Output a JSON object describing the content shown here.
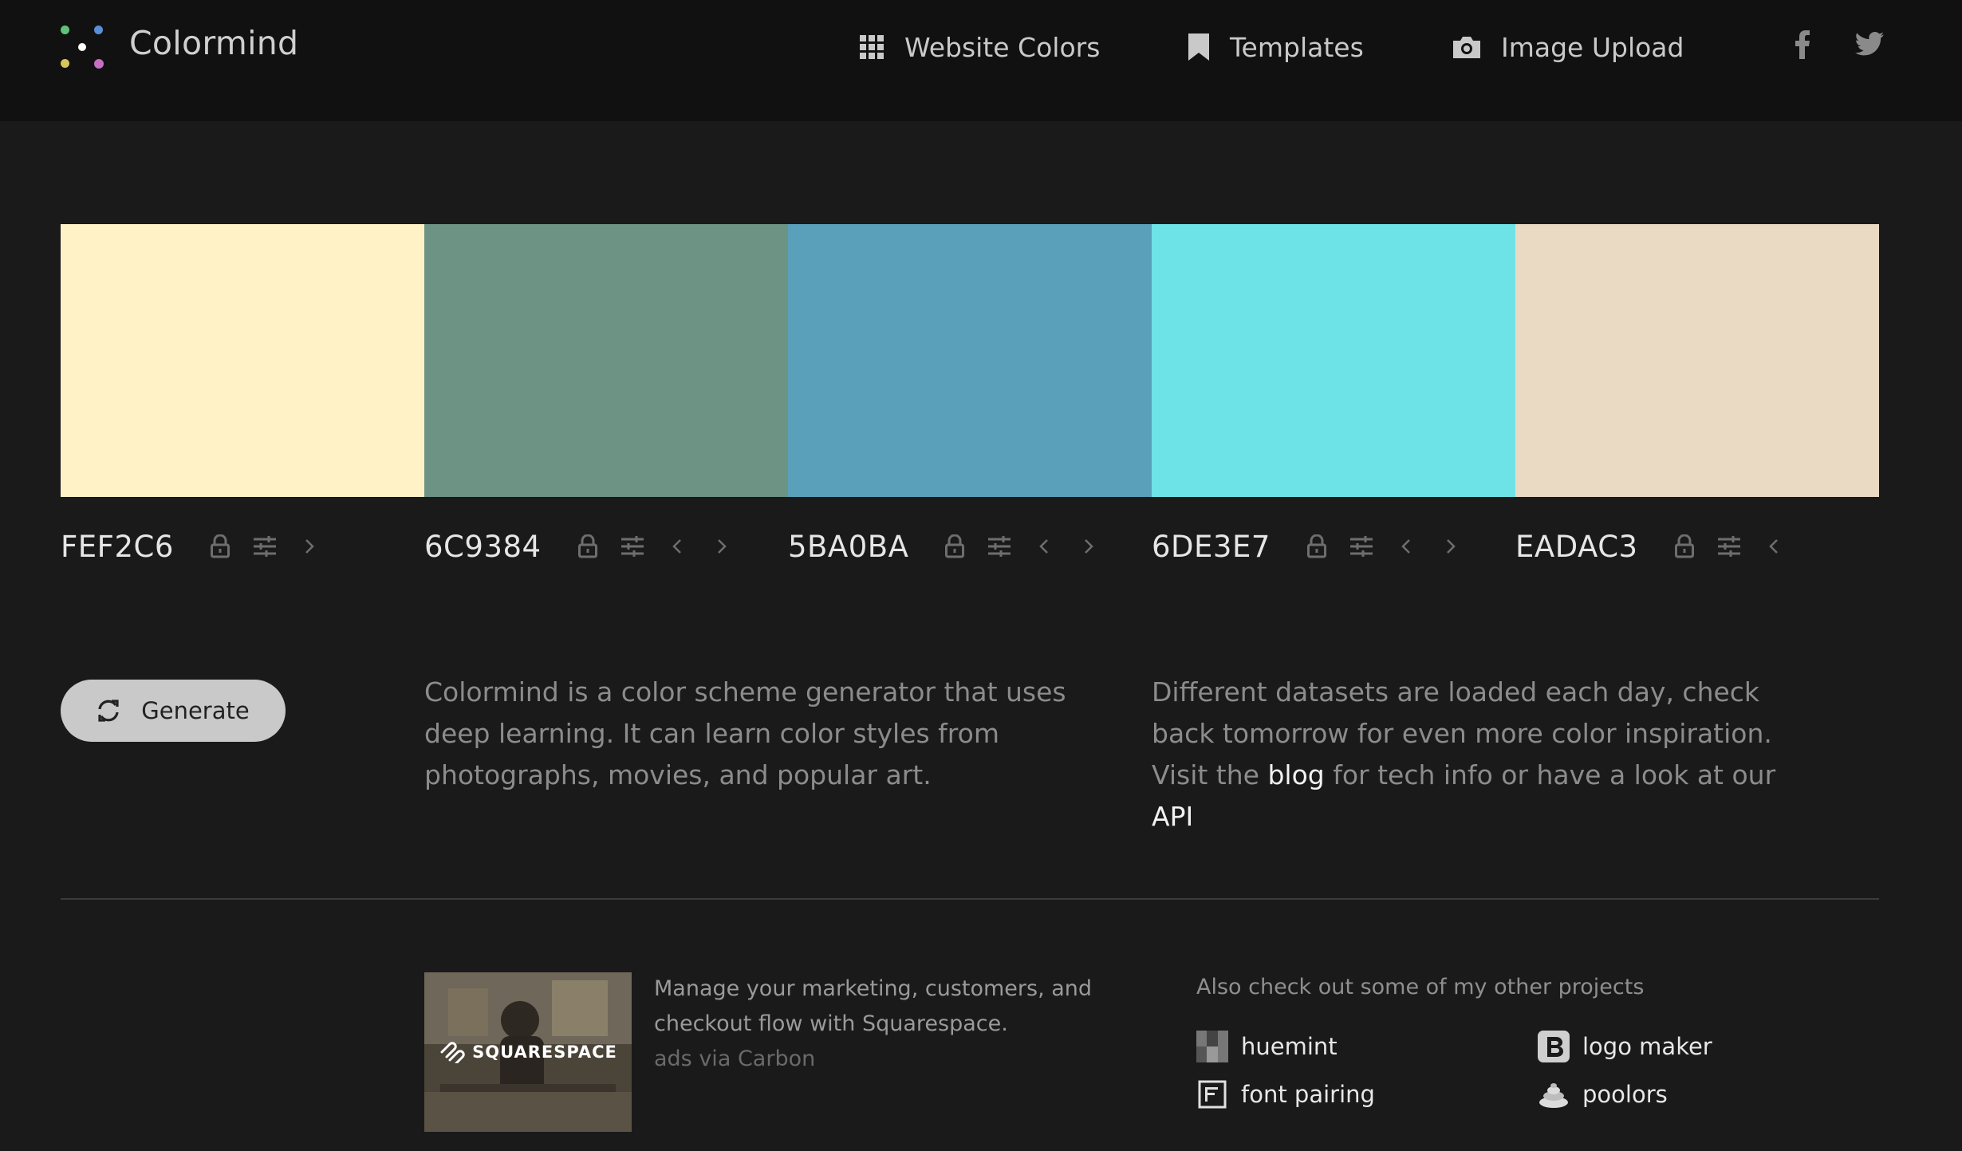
{
  "header": {
    "brand": "Colormind",
    "nav": [
      {
        "label": "Website Colors",
        "icon": "grid-icon"
      },
      {
        "label": "Templates",
        "icon": "bookmark-icon"
      },
      {
        "label": "Image Upload",
        "icon": "camera-icon"
      }
    ],
    "social": [
      "facebook-icon",
      "twitter-icon"
    ]
  },
  "palette": [
    {
      "hex": "FEF2C6",
      "color": "#FEF2C6",
      "controls": [
        "lock-icon",
        "adjust-icon",
        "chevron-right-icon"
      ]
    },
    {
      "hex": "6C9384",
      "color": "#6C9384",
      "controls": [
        "lock-icon",
        "adjust-icon",
        "chevron-left-icon",
        "chevron-right-icon"
      ]
    },
    {
      "hex": "5BA0BA",
      "color": "#5BA0BA",
      "controls": [
        "lock-icon",
        "adjust-icon",
        "chevron-left-icon",
        "chevron-right-icon"
      ]
    },
    {
      "hex": "6DE3E7",
      "color": "#6DE3E7",
      "controls": [
        "lock-icon",
        "adjust-icon",
        "chevron-left-icon",
        "chevron-right-icon"
      ]
    },
    {
      "hex": "EADAC3",
      "color": "#EADAC3",
      "controls": [
        "lock-icon",
        "adjust-icon",
        "chevron-left-icon"
      ]
    }
  ],
  "generate": {
    "label": "Generate",
    "icon": "refresh-icon"
  },
  "intro": {
    "text": "Colormind is a color scheme generator that uses deep learning. It can learn color styles from photographs, movies, and popular art."
  },
  "info": {
    "text_before": "Different datasets are loaded each day, check back tomorrow for even more color inspiration. Visit the ",
    "blog_link": "blog",
    "text_middle": " for tech info or have a look at our ",
    "api_link": "API"
  },
  "ad": {
    "image_text": "SQUARESPACE",
    "text": "Manage your marketing, customers, and checkout flow with Squarespace.",
    "via": "ads via Carbon"
  },
  "projects": {
    "title": "Also check out some of my other projects",
    "items": [
      {
        "label": "huemint",
        "icon": "huemint-icon"
      },
      {
        "label": "logo maker",
        "icon": "logo-maker-icon"
      },
      {
        "label": "font pairing",
        "icon": "font-pairing-icon"
      },
      {
        "label": "poolors",
        "icon": "poolors-icon"
      }
    ]
  }
}
